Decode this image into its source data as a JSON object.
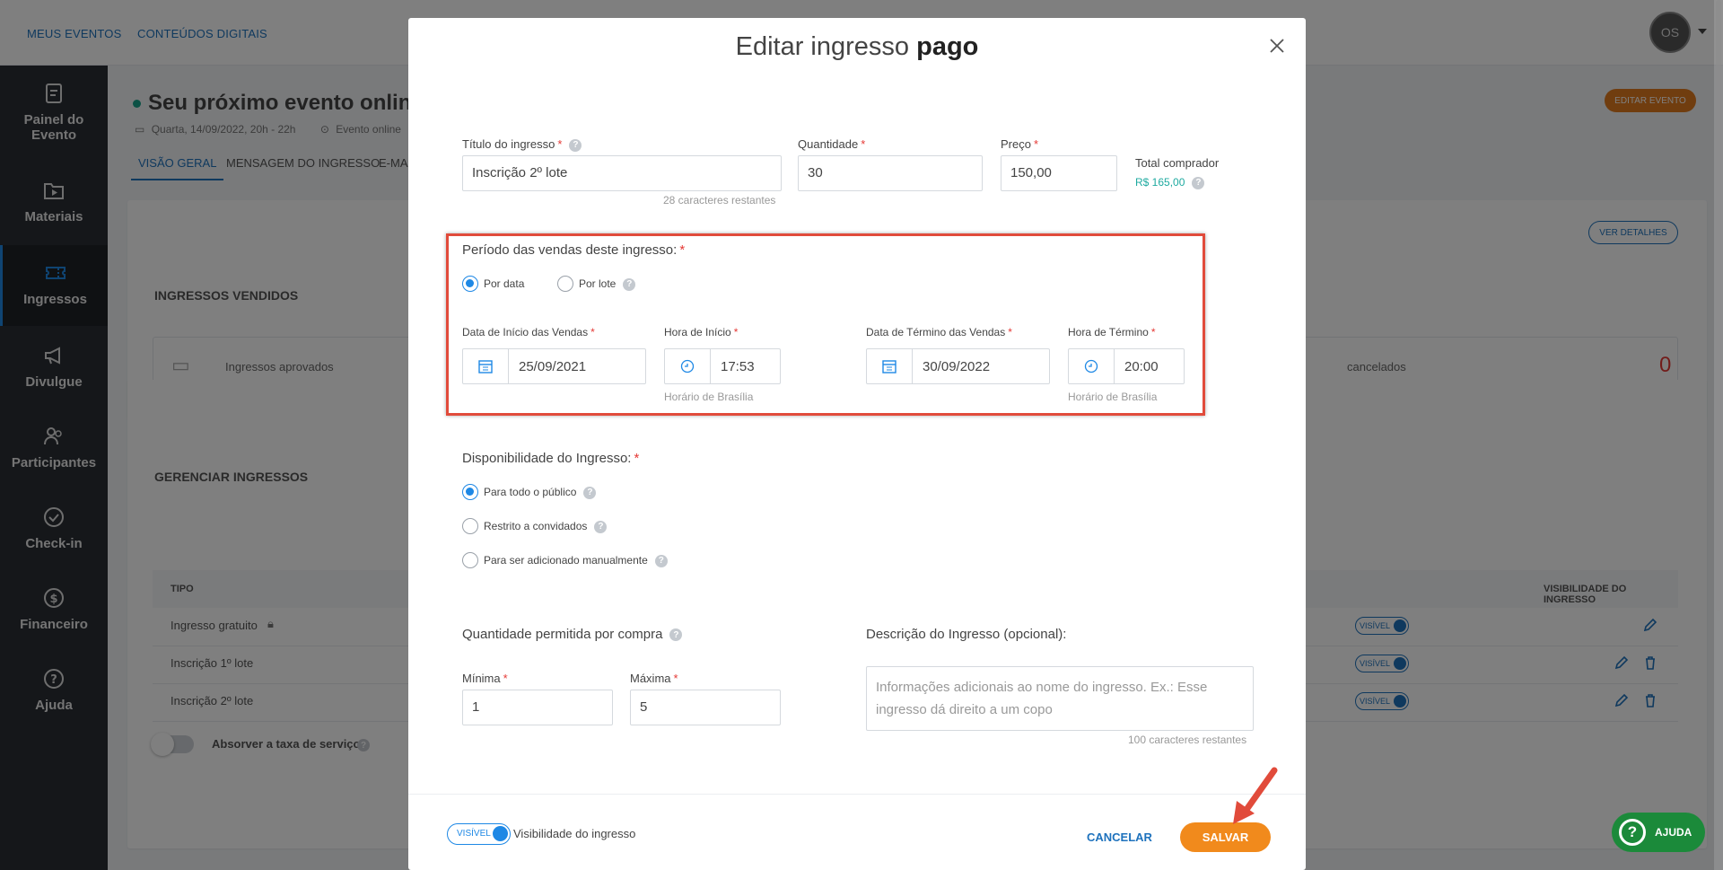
{
  "topnav": {
    "my_events": "MEUS EVENTOS",
    "digital_content": "CONTEÚDOS DIGITAIS",
    "avatar_initials": "OS"
  },
  "sidebar": {
    "items": [
      {
        "label": "Painel do Evento",
        "icon": "dashboard-icon"
      },
      {
        "label": "Materiais",
        "icon": "materials-icon"
      },
      {
        "label": "Ingressos",
        "icon": "ticket-icon",
        "active": true
      },
      {
        "label": "Divulgue",
        "icon": "megaphone-icon"
      },
      {
        "label": "Participantes",
        "icon": "participants-icon"
      },
      {
        "label": "Check-in",
        "icon": "checkin-icon"
      },
      {
        "label": "Financeiro",
        "icon": "dollar-icon"
      },
      {
        "label": "Ajuda",
        "icon": "help-icon"
      }
    ]
  },
  "event": {
    "title": "Seu próximo evento online",
    "date": "Quarta, 14/09/2022, 20h - 22h",
    "location": "Evento online",
    "edit_button": "EDITAR EVENTO",
    "tabs": [
      "VISÃO GERAL",
      "MENSAGEM DO INGRESSO",
      "E-MAI"
    ]
  },
  "sold": {
    "title": "INGRESSOS VENDIDOS",
    "details_button": "VER DETALHES",
    "approved_label": "Ingressos aprovados",
    "cancelled_label": "cancelados",
    "cancelled_value": "0"
  },
  "manage": {
    "title": "GERENCIAR INGRESSOS",
    "col_type": "TIPO",
    "col_visibility": "VISIBILIDADE DO INGRESSO",
    "visible_chip": "VISÍVEL",
    "rows": [
      "Ingresso gratuito",
      "Inscrição 1º lote",
      "Inscrição 2º lote"
    ],
    "absorb_label": "Absorver a taxa de serviço"
  },
  "modal": {
    "title_normal": "Editar ingresso",
    "title_bold": "pago",
    "ticket_title_label": "Título do ingresso",
    "ticket_title_value": "Inscrição 2º lote",
    "chars_left": "28 caracteres restantes",
    "quantity_label": "Quantidade",
    "quantity_value": "30",
    "price_label": "Preço",
    "price_value": "150,00",
    "total_label": "Total comprador",
    "total_value": "R$ 165,00",
    "period_label": "Período das vendas deste ingresso:",
    "by_date": "Por data",
    "by_batch": "Por lote",
    "start_date_label": "Data de Início das Vendas",
    "start_date_value": "25/09/2021",
    "start_time_label": "Hora de Início",
    "start_time_value": "17:53",
    "end_date_label": "Data de Término das Vendas",
    "end_date_value": "30/09/2022",
    "end_time_label": "Hora de Término",
    "end_time_value": "20:00",
    "timezone_hint": "Horário de Brasília",
    "availability_label": "Disponibilidade do Ingresso:",
    "avail_public": "Para todo o público",
    "avail_restricted": "Restrito a convidados",
    "avail_manual": "Para ser adicionado manualmente",
    "qty_per_purchase_label": "Quantidade permitida por compra",
    "min_label": "Mínima",
    "min_value": "1",
    "max_label": "Máxima",
    "max_value": "5",
    "description_label": "Descrição do Ingresso (opcional):",
    "description_placeholder": "Informações adicionais ao nome do ingresso. Ex.: Esse ingresso dá direito a um copo",
    "description_chars_left": "100 caracteres restantes",
    "visibility_chip": "VISÍVEL",
    "visibility_label": "Visibilidade do ingresso",
    "cancel": "CANCELAR",
    "save": "SALVAR"
  },
  "help_button": "AJUDA",
  "colors": {
    "accent_blue": "#1e88e5",
    "save_orange": "#f18a1c",
    "highlight_red": "#e14b3b",
    "sidebar_bg": "#2a2e34"
  }
}
